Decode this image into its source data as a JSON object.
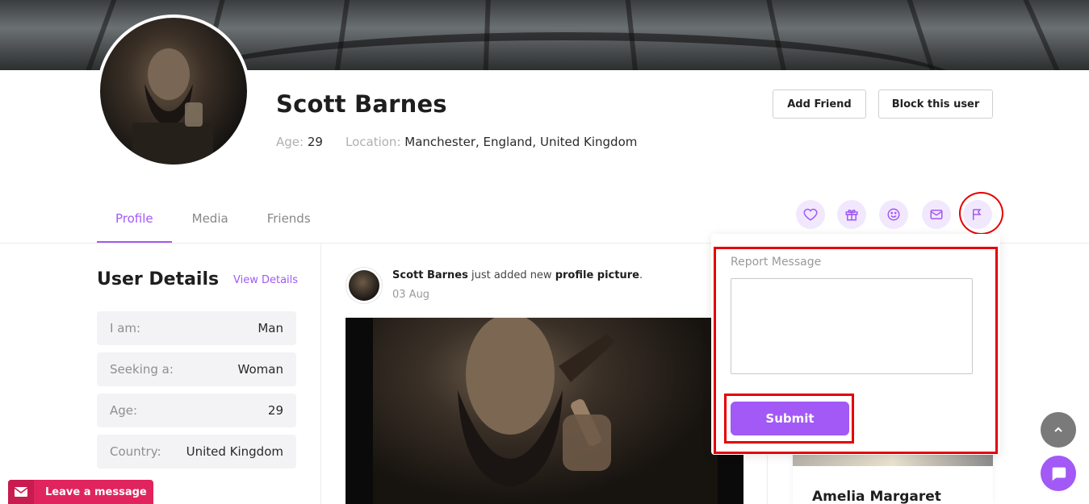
{
  "profile": {
    "name": "Scott Barnes",
    "age_label": "Age:",
    "age_value": "29",
    "location_label": "Location:",
    "location_value": "Manchester, England, United Kingdom"
  },
  "actions": {
    "add_friend": "Add Friend",
    "block_user": "Block this user"
  },
  "tabs": [
    {
      "label": "Profile",
      "active": true
    },
    {
      "label": "Media",
      "active": false
    },
    {
      "label": "Friends",
      "active": false
    }
  ],
  "action_icons": [
    "heart-icon",
    "gift-icon",
    "smile-icon",
    "mail-icon",
    "flag-icon"
  ],
  "user_details": {
    "title": "User Details",
    "view_link": "View Details",
    "rows": [
      {
        "key": "I am:",
        "value": "Man"
      },
      {
        "key": "Seeking a:",
        "value": "Woman"
      },
      {
        "key": "Age:",
        "value": "29"
      },
      {
        "key": "Country:",
        "value": "United Kingdom"
      }
    ]
  },
  "post": {
    "author": "Scott Barnes",
    "action_text": " just added new ",
    "object": "profile picture",
    "period": ".",
    "date": "03 Aug"
  },
  "report": {
    "label": "Report Message",
    "textarea_value": "",
    "submit": "Submit"
  },
  "member": {
    "name": "Amelia Margaret"
  },
  "leave_message": "Leave a message",
  "colors": {
    "accent": "#a259f5",
    "highlight": "#e60000",
    "leave_msg": "#e0245e"
  }
}
